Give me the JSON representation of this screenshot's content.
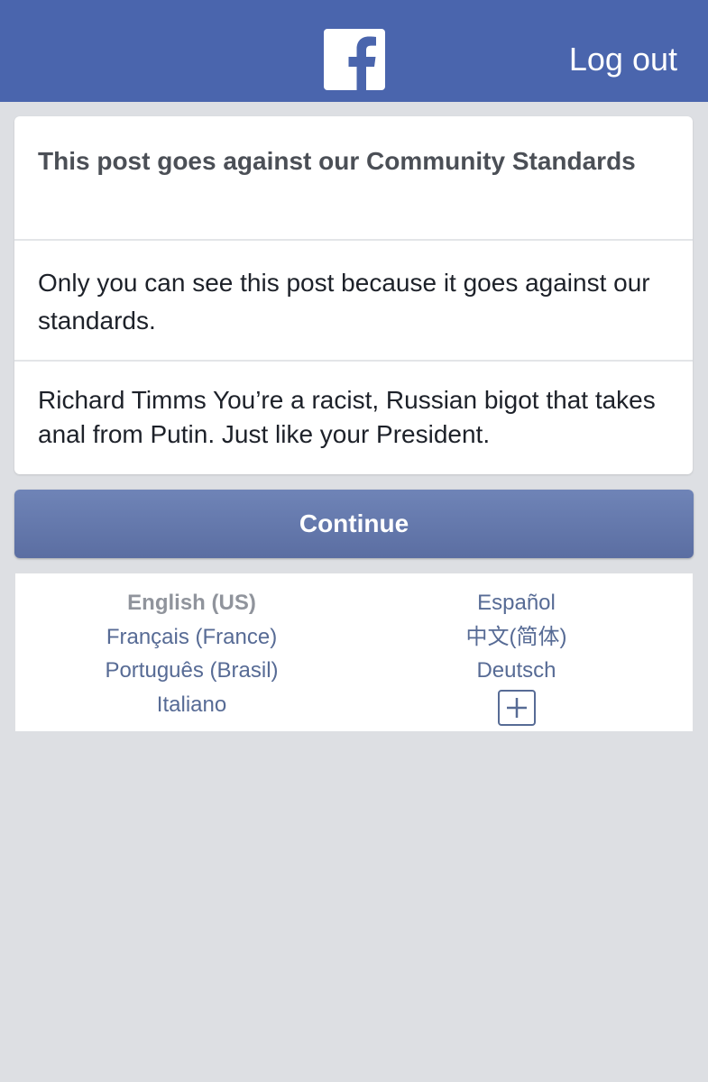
{
  "header": {
    "logout_label": "Log out",
    "brand_color": "#4a65ad",
    "logo_icon": "facebook-f-icon"
  },
  "notice": {
    "title": "This post goes against our Community Standards",
    "body": "Only you can see this post because it goes against our standards.",
    "post_text": "Richard Timms You’re a racist, Russian bigot that takes anal from Putin. Just like your President."
  },
  "actions": {
    "continue_label": "Continue"
  },
  "languages": {
    "left": [
      {
        "label": "English (US)"
      },
      {
        "label": "Français (France)"
      },
      {
        "label": "Português (Brasil)"
      },
      {
        "label": "Italiano"
      }
    ],
    "right": [
      {
        "label": "Español"
      },
      {
        "label": "中文(简体)"
      },
      {
        "label": "Deutsch"
      }
    ],
    "current": "English (US)",
    "more_icon": "plus-icon"
  }
}
